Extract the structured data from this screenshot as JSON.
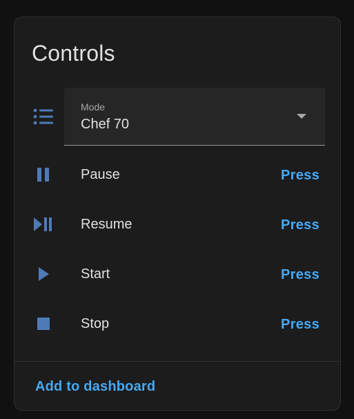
{
  "card": {
    "title": "Controls",
    "accent_color": "#46a9f3",
    "icon_color": "#4f7ab8"
  },
  "mode_select": {
    "icon": "format-list-bulleted-icon",
    "label": "Mode",
    "value": "Chef 70"
  },
  "rows": [
    {
      "name": "Pause",
      "icon": "pause-icon",
      "action_label": "Press"
    },
    {
      "name": "Resume",
      "icon": "play-pause-icon",
      "action_label": "Press"
    },
    {
      "name": "Start",
      "icon": "play-icon",
      "action_label": "Press"
    },
    {
      "name": "Stop",
      "icon": "stop-icon",
      "action_label": "Press"
    }
  ],
  "footer": {
    "add_to_dashboard_label": "Add to dashboard"
  }
}
